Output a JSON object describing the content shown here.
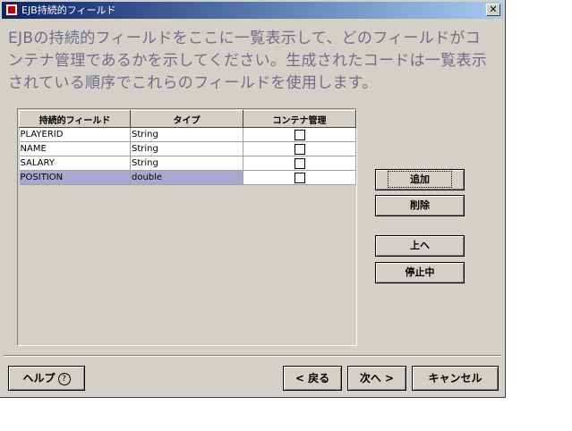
{
  "window": {
    "title": "EJB持続的フィールド",
    "close_label": "✕"
  },
  "description": "EJBの持続的フィールドをここに一覧表示して、どのフィールドがコンテナ管理であるかを示してください。生成されたコードは一覧表示されている順序でこれらのフィールドを使用します。",
  "table": {
    "headers": [
      "持続的フィールド",
      "タイプ",
      "コンテナ管理"
    ],
    "rows": [
      {
        "field": "PLAYERID",
        "type": "String",
        "container_managed": false
      },
      {
        "field": "NAME",
        "type": "String",
        "container_managed": false
      },
      {
        "field": "SALARY",
        "type": "String",
        "container_managed": false
      },
      {
        "field": "POSITION",
        "type": "double",
        "container_managed": false,
        "selected": true
      }
    ]
  },
  "side_buttons": {
    "add": "追加",
    "delete": "削除",
    "up": "上へ",
    "stop": "停止中"
  },
  "footer": {
    "help": "ヘルプ",
    "help_icon": "?",
    "back": "< 戻る",
    "next": "次へ >",
    "cancel": "キャンセル"
  },
  "colors": {
    "title_start": "#0a246a",
    "title_end": "#a6caf0",
    "selection": "#a8a8d0",
    "description_text": "#6e6e8c"
  }
}
